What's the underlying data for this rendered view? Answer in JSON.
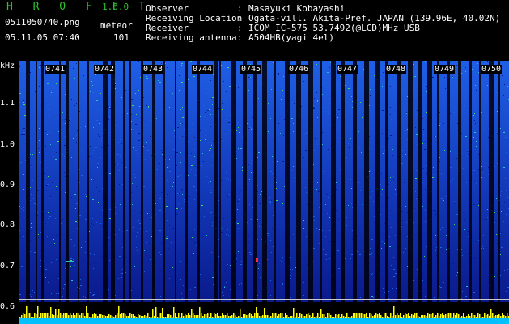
{
  "app": {
    "name": "H R O F F T",
    "version": "1.0.0"
  },
  "window": {
    "filename": "0511050740.png",
    "datetime": "05.11.05 07:40"
  },
  "counter": {
    "type": "meteor",
    "count": "101"
  },
  "info": [
    {
      "label": "Observer",
      "value": "Masayuki Kobayashi"
    },
    {
      "label": "Receiving Location",
      "value": "Ogata-vill. Akita-Pref. JAPAN (139.96E, 40.02N)"
    },
    {
      "label": "Receiver",
      "value": "ICOM IC-575 53.7492(@LCD)MHz USB"
    },
    {
      "label": "Receiving antenna",
      "value": "A504HB(yagi 4el)"
    }
  ],
  "separator": ":",
  "spectrogram": {
    "y_unit": "kHz",
    "y_ticks": [
      {
        "label": "1.1",
        "value": 1.1
      },
      {
        "label": "1.0",
        "value": 1.0
      },
      {
        "label": "0.9",
        "value": 0.9
      },
      {
        "label": "0.8",
        "value": 0.8
      },
      {
        "label": "0.7",
        "value": 0.7
      },
      {
        "label": "0.6",
        "value": 0.6
      }
    ],
    "time_marks": [
      {
        "label": "0741",
        "minute": 1
      },
      {
        "label": "0742",
        "minute": 2
      },
      {
        "label": "0743",
        "minute": 3
      },
      {
        "label": "0744",
        "minute": 4
      },
      {
        "label": "0745",
        "minute": 5
      },
      {
        "label": "0746",
        "minute": 6
      },
      {
        "label": "0747",
        "minute": 7
      },
      {
        "label": "0748",
        "minute": 8
      },
      {
        "label": "0749",
        "minute": 9
      },
      {
        "label": "0750",
        "minute": 10
      }
    ],
    "colors": {
      "background": "#000000",
      "noise_low": "#0a1a8c",
      "noise_mid": "#1f5fe6",
      "noise_high": "#2ec0c0",
      "peak": "#3ee060",
      "echo": "#ff2a2a",
      "level_bars": "#ffff00",
      "level_base": "#00c0ff",
      "reference_line": "#cccccc",
      "text": "#ffffff",
      "title": "#2ec02e"
    }
  }
}
